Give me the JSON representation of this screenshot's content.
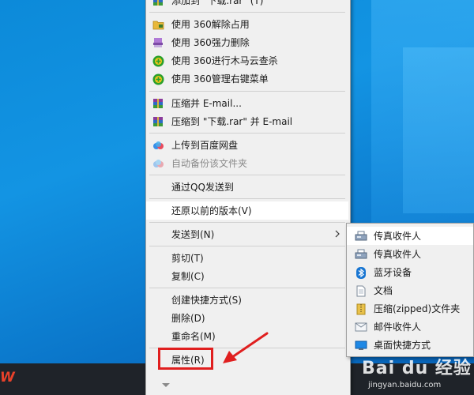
{
  "context_menu": {
    "items": [
      {
        "label": "添加到 \"下载.rar\" (T)",
        "icon": "winrar-icon"
      },
      {
        "label": "使用 360解除占用",
        "icon": "folder-lock-icon"
      },
      {
        "label": "使用 360强力删除",
        "icon": "shredder-icon"
      },
      {
        "label": "使用 360进行木马云查杀",
        "icon": "shield-360-icon"
      },
      {
        "label": "使用 360管理右键菜单",
        "icon": "shield-360-icon"
      },
      {
        "label": "压缩并 E-mail...",
        "icon": "winrar-icon"
      },
      {
        "label": "压缩到 \"下载.rar\" 并 E-mail",
        "icon": "winrar-icon"
      },
      {
        "label": "上传到百度网盘",
        "icon": "baidu-cloud-icon"
      },
      {
        "label": "自动备份该文件夹",
        "icon": "baidu-cloud-icon"
      },
      {
        "label": "通过QQ发送到"
      },
      {
        "label": "还原以前的版本(V)"
      },
      {
        "label": "发送到(N)"
      },
      {
        "label": "剪切(T)"
      },
      {
        "label": "复制(C)"
      },
      {
        "label": "创建快捷方式(S)"
      },
      {
        "label": "删除(D)"
      },
      {
        "label": "重命名(M)"
      },
      {
        "label": "属性(R)"
      }
    ]
  },
  "send_to_submenu": {
    "items": [
      {
        "label": "传真收件人",
        "icon": "fax-icon"
      },
      {
        "label": "传真收件人",
        "icon": "fax-icon"
      },
      {
        "label": "蓝牙设备",
        "icon": "bluetooth-icon"
      },
      {
        "label": "文档",
        "icon": "document-icon"
      },
      {
        "label": "压缩(zipped)文件夹",
        "icon": "zip-folder-icon"
      },
      {
        "label": "邮件收件人",
        "icon": "mail-icon"
      },
      {
        "label": "桌面快捷方式",
        "icon": "desktop-icon"
      }
    ]
  },
  "watermark": {
    "brand": "Bai du 经验",
    "url": "jingyan.baidu.com"
  },
  "colors": {
    "annotation_red": "#e01f1f",
    "desktop_blue": "#0a74c8",
    "menu_bg": "#f0f0f0"
  }
}
